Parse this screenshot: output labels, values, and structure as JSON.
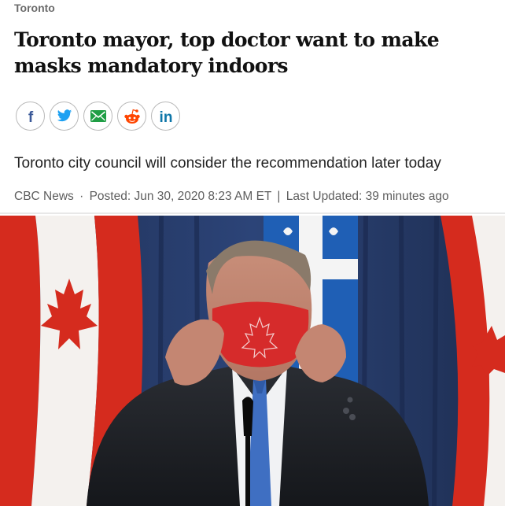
{
  "article": {
    "section": "Toronto",
    "headline": "Toronto mayor, top doctor want to make masks mandatory indoors",
    "deck": "Toronto city council will consider the recommendation later today",
    "byline": {
      "source": "CBC News",
      "separator_dot": "·",
      "posted": "Posted: Jun 30, 2020 8:23 AM ET",
      "separator_bar": "|",
      "updated": "Last Updated: 39 minutes ago"
    }
  },
  "share": [
    {
      "name": "facebook",
      "icon": "facebook-icon",
      "color": "#3b5998"
    },
    {
      "name": "twitter",
      "icon": "twitter-icon",
      "color": "#1da1f2"
    },
    {
      "name": "email",
      "icon": "email-icon",
      "color": "#1f9e45"
    },
    {
      "name": "reddit",
      "icon": "reddit-icon",
      "color": "#ff4500"
    },
    {
      "name": "linkedin",
      "icon": "linkedin-icon",
      "color": "#0e76a8"
    }
  ],
  "lead_image": {
    "subject": "man-in-suit-adjusting-red-maple-leaf-face-mask",
    "backdrop": "canadian-and-quebec-flags"
  }
}
